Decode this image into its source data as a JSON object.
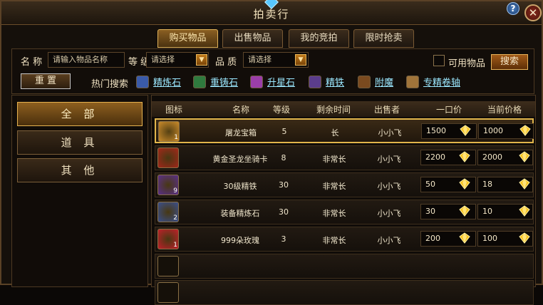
{
  "window": {
    "title": "拍卖行",
    "help": "?",
    "close": "✕"
  },
  "tabs": [
    "购买物品",
    "出售物品",
    "我的竞拍",
    "限时抢卖"
  ],
  "search": {
    "name_label": "名 称",
    "name_placeholder": "请输入物品名称",
    "level_label": "等 级",
    "level_value": "请选择",
    "quality_label": "品 质",
    "quality_value": "请选择",
    "usable_label": "可用物品",
    "search_button": "搜索",
    "reset_button": "重 置",
    "hot_label": "热门搜索",
    "hot_items": [
      "精炼石",
      "重铸石",
      "升星石",
      "精铁",
      "附魔",
      "专精卷轴"
    ]
  },
  "categories": [
    "全 部",
    "道 具",
    "其 他"
  ],
  "table": {
    "headers": [
      "图标",
      "名称",
      "等级",
      "剩余时间",
      "出售者",
      "一口价",
      "当前价格"
    ],
    "rows": [
      {
        "count": "1",
        "name": "屠龙宝箱",
        "level": "5",
        "time": "长",
        "seller": "小小飞",
        "buyout": "1500",
        "current": "1000",
        "icon_color": "#c98a2a"
      },
      {
        "count": "",
        "name": "黄金圣龙坐骑卡",
        "level": "8",
        "time": "非常长",
        "seller": "小小飞",
        "buyout": "2200",
        "current": "2000",
        "icon_color": "#a3271a"
      },
      {
        "count": "9",
        "name": "30级精铁",
        "level": "30",
        "time": "非常长",
        "seller": "小小飞",
        "buyout": "50",
        "current": "18",
        "icon_color": "#5a2f8a"
      },
      {
        "count": "2",
        "name": "装备精炼石",
        "level": "30",
        "time": "非常长",
        "seller": "小小飞",
        "buyout": "30",
        "current": "10",
        "icon_color": "#3a4f8c"
      },
      {
        "count": "1",
        "name": "999朵玫瑰",
        "level": "3",
        "time": "非常长",
        "seller": "小小飞",
        "buyout": "200",
        "current": "100",
        "icon_color": "#c0202a"
      }
    ]
  },
  "colors": {
    "accent": "#e1b54b",
    "link": "#9be8ff",
    "diamond": "#f7c21e"
  }
}
